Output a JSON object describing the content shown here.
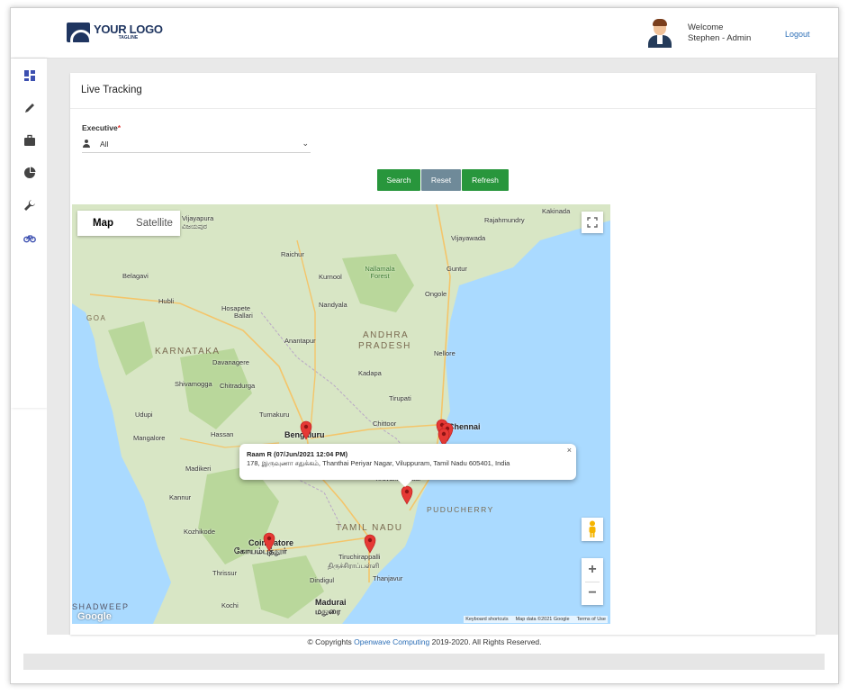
{
  "header": {
    "logo_text": "YOUR LOGO",
    "logo_tagline": "TAGLINE",
    "welcome_line1": "Welcome",
    "welcome_line2": "Stephen - Admin",
    "logout_label": "Logout"
  },
  "sidebar": {
    "items": [
      {
        "icon": "dashboard-icon"
      },
      {
        "icon": "pencil-icon"
      },
      {
        "icon": "briefcase-icon"
      },
      {
        "icon": "pie-chart-icon"
      },
      {
        "icon": "wrench-icon"
      },
      {
        "icon": "bicycle-icon",
        "active": true
      }
    ],
    "active_color": "#3c4fb0"
  },
  "page": {
    "title": "Live Tracking"
  },
  "form": {
    "executive_label": "Executive",
    "required_mark": "*",
    "executive_value": "All",
    "search_label": "Search",
    "reset_label": "Reset",
    "refresh_label": "Refresh"
  },
  "colors": {
    "primary_button": "#28963c",
    "reset_button": "#6f8a99",
    "link": "#2d6fb7",
    "marker": "#e53935",
    "sea": "#aadaff",
    "land": "#c8ddb1"
  },
  "map": {
    "tab_map": "Map",
    "tab_satellite": "Satellite",
    "region_labels": [
      {
        "text": "KARNATAKA"
      },
      {
        "text": "ANDHRA"
      },
      {
        "text": "PRADESH"
      },
      {
        "text": "TAMIL NADU"
      },
      {
        "text": "PUDUCHERRY"
      },
      {
        "text": "GOA"
      },
      {
        "text": "SHADWEEP"
      }
    ],
    "cities": [
      {
        "text": "Vijayapura"
      },
      {
        "text": "ವಿಜಯಪುರ"
      },
      {
        "text": "Rajahmundry"
      },
      {
        "text": "Kakinada"
      },
      {
        "text": "Vijayawada"
      },
      {
        "text": "Raichur"
      },
      {
        "text": "Belagavi"
      },
      {
        "text": "Kurnool"
      },
      {
        "text": "Nallamala Forest"
      },
      {
        "text": "Guntur"
      },
      {
        "text": "Hubli"
      },
      {
        "text": "Hosapete"
      },
      {
        "text": "Ballari"
      },
      {
        "text": "Nandyala"
      },
      {
        "text": "Ongole"
      },
      {
        "text": "Anantapur"
      },
      {
        "text": "Nellore"
      },
      {
        "text": "Davanagere"
      },
      {
        "text": "Shivamogga"
      },
      {
        "text": "Chitradurga"
      },
      {
        "text": "Kadapa"
      },
      {
        "text": "Tirupati"
      },
      {
        "text": "Udupi"
      },
      {
        "text": "Tumakuru"
      },
      {
        "text": "Chittoor"
      },
      {
        "text": "Mangalore"
      },
      {
        "text": "Hassan"
      },
      {
        "text": "Bengaluru"
      },
      {
        "text": "Chennai"
      },
      {
        "text": "Madikeri"
      },
      {
        "text": "Kannur"
      },
      {
        "text": "Tiruvannamalai"
      },
      {
        "text": "Kozhikode"
      },
      {
        "text": "Coimbatore"
      },
      {
        "text": "கோயம்புத்தூர்"
      },
      {
        "text": "Tiruchirappalli"
      },
      {
        "text": "திருச்சிராப்பள்ளி"
      },
      {
        "text": "Thrissur"
      },
      {
        "text": "Dindigul"
      },
      {
        "text": "Thanjavur"
      },
      {
        "text": "Kochi"
      },
      {
        "text": "Madurai"
      },
      {
        "text": "மதுரை"
      }
    ],
    "markers_count": 8,
    "info_title": "Raam R (07/Jun/2021 12:04 PM)",
    "info_address": "178, இருவுணா சதுக்கம், Thanthai Periyar Nagar, Viluppuram, Tamil Nadu 605401, India",
    "attribution_shortcuts": "Keyboard shortcuts",
    "attribution_data": "Map data ©2021 Google",
    "attribution_terms": "Terms of Use",
    "google_wordmark": "Google"
  },
  "footer": {
    "prefix": "© Copyrights",
    "company": "Openwave Computing",
    "suffix": "2019-2020. All Rights Reserved."
  }
}
